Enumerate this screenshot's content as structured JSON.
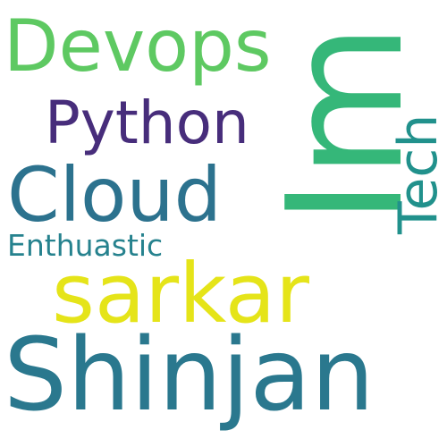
{
  "cloud": {
    "words": [
      {
        "text": "Devops",
        "color": "#5ec962"
      },
      {
        "text": "Im",
        "color": "#35b779"
      },
      {
        "text": "Python",
        "color": "#472d7b"
      },
      {
        "text": "Tech",
        "color": "#21918c"
      },
      {
        "text": "Cloud",
        "color": "#2c728e"
      },
      {
        "text": "Enthuastic",
        "color": "#26828e"
      },
      {
        "text": "sarkar",
        "color": "#e5e419"
      },
      {
        "text": "Shinjan",
        "color": "#2a788e"
      }
    ]
  }
}
